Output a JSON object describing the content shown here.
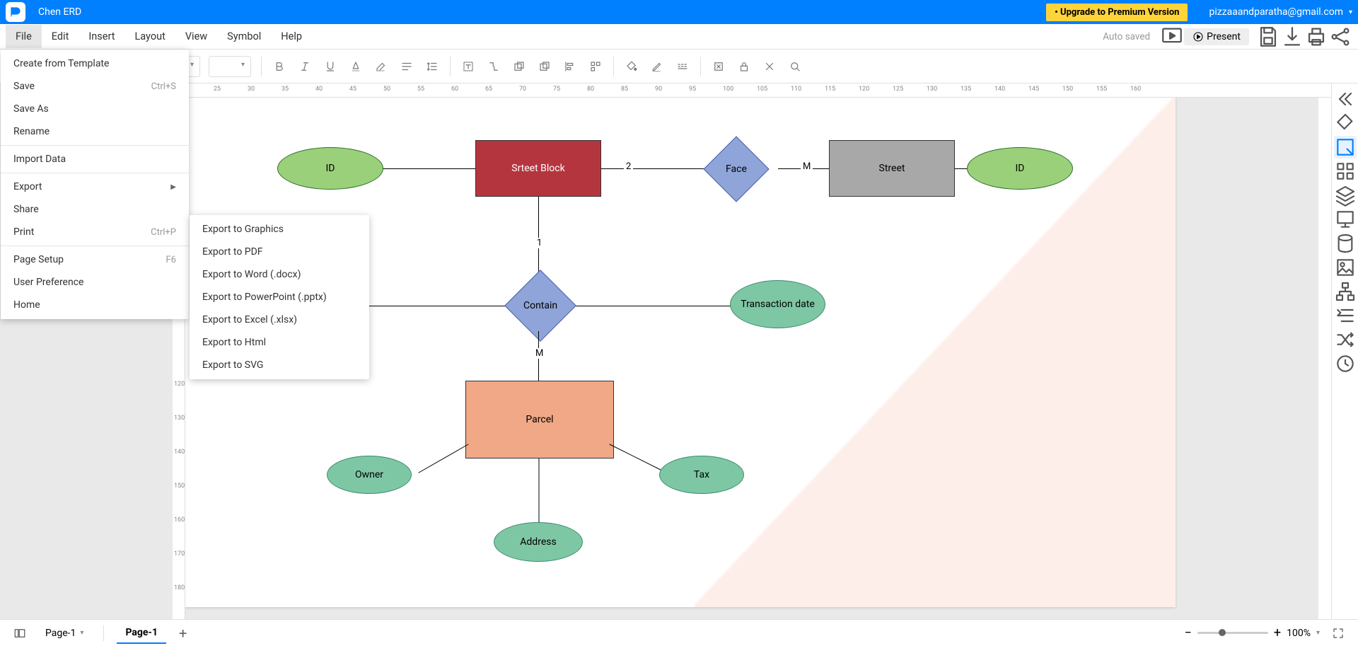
{
  "app": {
    "doc_title": "Chen ERD",
    "upgrade": "• Upgrade to Premium Version",
    "email": "pizzaaandparatha@gmail.com"
  },
  "menubar": {
    "items": [
      "File",
      "Edit",
      "Insert",
      "Layout",
      "View",
      "Symbol",
      "Help"
    ],
    "autosaved": "Auto saved",
    "present": "Present"
  },
  "file_menu": {
    "items": [
      {
        "label": "Create from Template",
        "shortcut": ""
      },
      {
        "label": "Save",
        "shortcut": "Ctrl+S"
      },
      {
        "label": "Save As",
        "shortcut": ""
      },
      {
        "label": "Rename",
        "shortcut": ""
      },
      {
        "sep": true
      },
      {
        "label": "Import Data",
        "shortcut": ""
      },
      {
        "sep": true
      },
      {
        "label": "Export",
        "shortcut": "",
        "arrow": true
      },
      {
        "label": "Share",
        "shortcut": ""
      },
      {
        "label": "Print",
        "shortcut": "Ctrl+P"
      },
      {
        "sep": true
      },
      {
        "label": "Page Setup",
        "shortcut": "F6"
      },
      {
        "label": "User Preference",
        "shortcut": ""
      },
      {
        "label": "Home",
        "shortcut": ""
      }
    ]
  },
  "export_menu": {
    "items": [
      "Export to Graphics",
      "Export to PDF",
      "Export to Word (.docx)",
      "Export to PowerPoint (.pptx)",
      "Export to Excel (.xlsx)",
      "Export to Html",
      "Export to SVG"
    ]
  },
  "erd": {
    "id1": "ID",
    "street_block": "Srteet Block",
    "face": "Face",
    "street": "Street",
    "id2": "ID",
    "contain": "Contain",
    "transaction": "Transaction date",
    "parcel": "Parcel",
    "owner": "Owner",
    "tax": "Tax",
    "address": "Address",
    "label_2": "2",
    "label_M1": "M",
    "label_1": "1",
    "label_M2": "M"
  },
  "ruler_h": [
    "25",
    "30",
    "35",
    "40",
    "45",
    "50",
    "55",
    "60",
    "65",
    "70",
    "75",
    "80",
    "85",
    "90",
    "95",
    "100",
    "105",
    "110",
    "115",
    "120",
    "125",
    "130",
    "135",
    "140",
    "145",
    "150",
    "155",
    "160"
  ],
  "ruler_v": [
    "120",
    "130",
    "140",
    "150",
    "160",
    "170",
    "180"
  ],
  "bottom": {
    "page_dropdown": "Page-1",
    "page_tab": "Page-1",
    "zoom": "100%"
  }
}
